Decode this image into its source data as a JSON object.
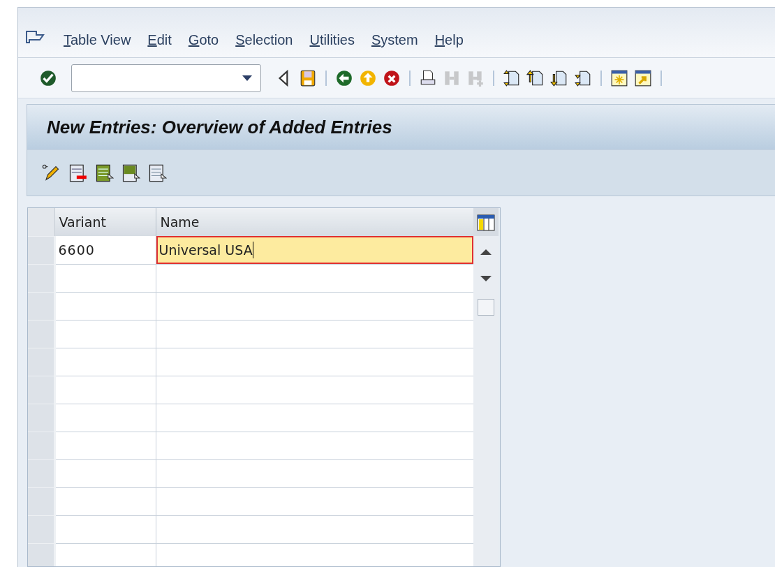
{
  "menu_bar": [
    {
      "label": "Table View"
    },
    {
      "label": "Edit"
    },
    {
      "label": "Goto"
    },
    {
      "label": "Selection"
    },
    {
      "label": "Utilities"
    },
    {
      "label": "System"
    },
    {
      "label": "Help"
    }
  ],
  "toolbar": [
    {
      "kind": "enter",
      "disabled": false
    },
    {
      "kind": "field"
    },
    {
      "kind": "collapse",
      "disabled": false
    },
    {
      "kind": "save",
      "disabled": false
    },
    {
      "kind": "sep"
    },
    {
      "kind": "back",
      "disabled": false
    },
    {
      "kind": "exit",
      "disabled": false
    },
    {
      "kind": "cancel",
      "disabled": false
    },
    {
      "kind": "sep"
    },
    {
      "kind": "print",
      "disabled": false
    },
    {
      "kind": "find",
      "disabled": true
    },
    {
      "kind": "find_next",
      "disabled": true
    },
    {
      "kind": "sep"
    },
    {
      "kind": "first_page",
      "disabled": false
    },
    {
      "kind": "prev_page",
      "disabled": false
    },
    {
      "kind": "next_page",
      "disabled": false
    },
    {
      "kind": "last_page",
      "disabled": false
    },
    {
      "kind": "sep"
    },
    {
      "kind": "new_session",
      "disabled": false
    },
    {
      "kind": "shortcut",
      "disabled": false
    },
    {
      "kind": "sep"
    }
  ],
  "title": "New Entries: Overview of Added Entries",
  "app_toolbar": [
    {
      "kind": "display_change"
    },
    {
      "kind": "delete_row"
    },
    {
      "kind": "select_all"
    },
    {
      "kind": "select_block"
    },
    {
      "kind": "deselect_all"
    }
  ],
  "table": {
    "columns": [
      "Variant",
      "Name"
    ],
    "rows": [
      {
        "variant": "6600",
        "name": "Universal USA",
        "focused": true
      }
    ]
  }
}
